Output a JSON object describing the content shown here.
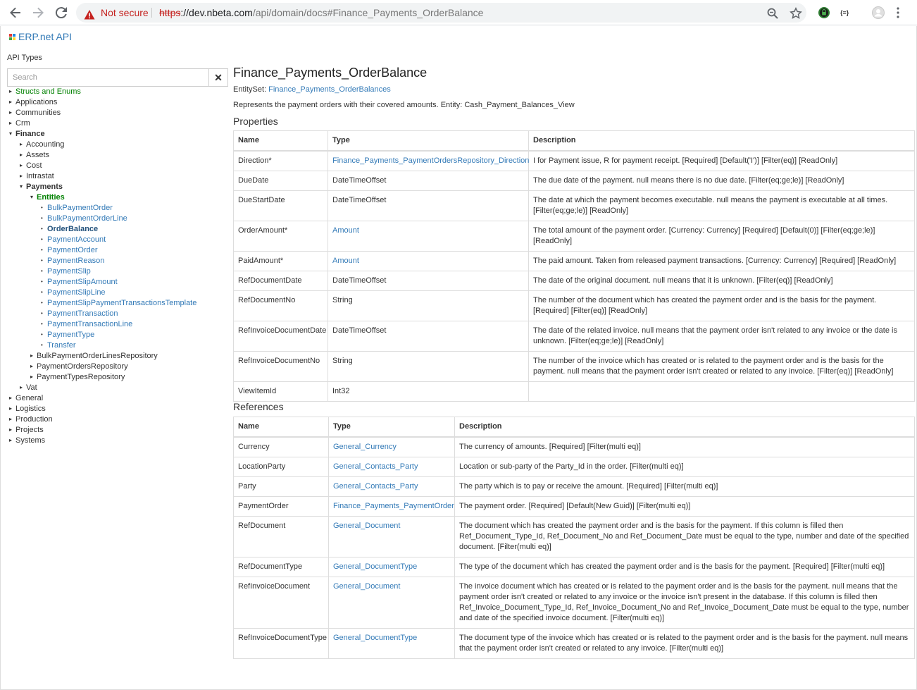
{
  "browser": {
    "security_label": "Not secure",
    "url_scheme": "https",
    "url_host": "://dev.nbeta.com",
    "url_path": "/api/domain/docs#Finance_Payments_OrderBalance"
  },
  "header": {
    "brand": "ERP.net API",
    "api_types_label": "API Types",
    "search_placeholder": "Search",
    "clear_label": "✕"
  },
  "tree": [
    {
      "label": "Structs and Enums",
      "level": 0,
      "style": "green"
    },
    {
      "label": "Applications",
      "level": 0,
      "style": "folder"
    },
    {
      "label": "Communities",
      "level": 0,
      "style": "folder"
    },
    {
      "label": "Crm",
      "level": 0,
      "style": "folder"
    },
    {
      "label": "Finance",
      "level": 0,
      "style": "bold",
      "expanded": true
    },
    {
      "label": "Accounting",
      "level": 1,
      "style": "folder"
    },
    {
      "label": "Assets",
      "level": 1,
      "style": "folder"
    },
    {
      "label": "Cost",
      "level": 1,
      "style": "folder"
    },
    {
      "label": "Intrastat",
      "level": 1,
      "style": "folder"
    },
    {
      "label": "Payments",
      "level": 1,
      "style": "bold",
      "expanded": true
    },
    {
      "label": "Entities",
      "level": 2,
      "style": "bold green",
      "expanded": true
    },
    {
      "label": "BulkPaymentOrder",
      "level": 3,
      "style": "link"
    },
    {
      "label": "BulkPaymentOrderLine",
      "level": 3,
      "style": "link"
    },
    {
      "label": "OrderBalance",
      "level": 3,
      "style": "active"
    },
    {
      "label": "PaymentAccount",
      "level": 3,
      "style": "link"
    },
    {
      "label": "PaymentOrder",
      "level": 3,
      "style": "link"
    },
    {
      "label": "PaymentReason",
      "level": 3,
      "style": "link"
    },
    {
      "label": "PaymentSlip",
      "level": 3,
      "style": "link"
    },
    {
      "label": "PaymentSlipAmount",
      "level": 3,
      "style": "link"
    },
    {
      "label": "PaymentSlipLine",
      "level": 3,
      "style": "link"
    },
    {
      "label": "PaymentSlipPaymentTransactionsTemplate",
      "level": 3,
      "style": "link"
    },
    {
      "label": "PaymentTransaction",
      "level": 3,
      "style": "link"
    },
    {
      "label": "PaymentTransactionLine",
      "level": 3,
      "style": "link"
    },
    {
      "label": "PaymentType",
      "level": 3,
      "style": "link"
    },
    {
      "label": "Transfer",
      "level": 3,
      "style": "link"
    },
    {
      "label": "BulkPaymentOrderLinesRepository",
      "level": 2,
      "style": "folder"
    },
    {
      "label": "PaymentOrdersRepository",
      "level": 2,
      "style": "folder"
    },
    {
      "label": "PaymentTypesRepository",
      "level": 2,
      "style": "folder"
    },
    {
      "label": "Vat",
      "level": 1,
      "style": "folder"
    },
    {
      "label": "General",
      "level": 0,
      "style": "folder"
    },
    {
      "label": "Logistics",
      "level": 0,
      "style": "folder"
    },
    {
      "label": "Production",
      "level": 0,
      "style": "folder"
    },
    {
      "label": "Projects",
      "level": 0,
      "style": "folder"
    },
    {
      "label": "Systems",
      "level": 0,
      "style": "folder"
    }
  ],
  "main": {
    "title": "Finance_Payments_OrderBalance",
    "entity_set_label": "EntitySet:",
    "entity_set_link": "Finance_Payments_OrderBalances",
    "summary": "Represents the payment orders with their covered amounts. Entity: Cash_Payment_Balances_View",
    "properties_heading": "Properties",
    "properties_columns": [
      "Name",
      "Type",
      "Description"
    ],
    "properties": [
      {
        "name": "Direction*",
        "type": "Finance_Payments_PaymentOrdersRepository_Direction",
        "type_link": true,
        "desc": "I for Payment issue, R for payment receipt. [Required] [Default('I')] [Filter(eq)] [ReadOnly]"
      },
      {
        "name": "DueDate",
        "type": "DateTimeOffset",
        "type_link": false,
        "desc": "The due date of the payment. null means there is no due date. [Filter(eq;ge;le)] [ReadOnly]"
      },
      {
        "name": "DueStartDate",
        "type": "DateTimeOffset",
        "type_link": false,
        "desc": "The date at which the payment becomes executable. null means the payment is executable at all times. [Filter(eq;ge;le)] [ReadOnly]"
      },
      {
        "name": "OrderAmount*",
        "type": "Amount",
        "type_link": true,
        "desc": "The total amount of the payment order. [Currency: Currency] [Required] [Default(0)] [Filter(eq;ge;le)] [ReadOnly]"
      },
      {
        "name": "PaidAmount*",
        "type": "Amount",
        "type_link": true,
        "desc": "The paid amount. Taken from released payment transactions. [Currency: Currency] [Required] [ReadOnly]"
      },
      {
        "name": "RefDocumentDate",
        "type": "DateTimeOffset",
        "type_link": false,
        "desc": "The date of the original document. null means that it is unknown. [Filter(eq)] [ReadOnly]"
      },
      {
        "name": "RefDocumentNo",
        "type": "String",
        "type_link": false,
        "desc": "The number of the document which has created the payment order and is the basis for the payment. [Required] [Filter(eq)] [ReadOnly]"
      },
      {
        "name": "RefInvoiceDocumentDate",
        "type": "DateTimeOffset",
        "type_link": false,
        "desc": "The date of the related invoice. null means that the payment order isn't related to any invoice or the date is unknown. [Filter(eq;ge;le)] [ReadOnly]"
      },
      {
        "name": "RefInvoiceDocumentNo",
        "type": "String",
        "type_link": false,
        "desc": "The number of the invoice which has created or is related to the payment order and is the basis for the payment. null means that the payment order isn't created or related to any invoice. [Filter(eq)] [ReadOnly]"
      },
      {
        "name": "ViewItemId",
        "type": "Int32",
        "type_link": false,
        "desc": ""
      }
    ],
    "references_heading": "References",
    "references_columns": [
      "Name",
      "Type",
      "Description"
    ],
    "references": [
      {
        "name": "Currency",
        "type": "General_Currency",
        "desc": "The currency of amounts. [Required] [Filter(multi eq)]"
      },
      {
        "name": "LocationParty",
        "type": "General_Contacts_Party",
        "desc": "Location or sub-party of the Party_Id in the order. [Filter(multi eq)]"
      },
      {
        "name": "Party",
        "type": "General_Contacts_Party",
        "desc": "The party which is to pay or receive the amount. [Required] [Filter(multi eq)]"
      },
      {
        "name": "PaymentOrder",
        "type": "Finance_Payments_PaymentOrder",
        "desc": "The payment order. [Required] [Default(New Guid)] [Filter(multi eq)]"
      },
      {
        "name": "RefDocument",
        "type": "General_Document",
        "desc": "The document which has created the payment order and is the basis for the payment. If this column is filled then Ref_Document_Type_Id, Ref_Document_No and Ref_Document_Date must be equal to the type, number and date of the specified document. [Filter(multi eq)]"
      },
      {
        "name": "RefDocumentType",
        "type": "General_DocumentType",
        "desc": "The type of the document which has created the payment order and is the basis for the payment. [Required] [Filter(multi eq)]"
      },
      {
        "name": "RefInvoiceDocument",
        "type": "General_Document",
        "desc": "The invoice document which has created or is related to the payment order and is the basis for the payment. null means that the payment order isn't created or related to any invoice or the invoice isn't present in the database. If this column is filled then Ref_Invoice_Document_Type_Id, Ref_Invoice_Document_No and Ref_Invoice_Document_Date must be equal to the type, number and date of the specified invoice document. [Filter(multi eq)]"
      },
      {
        "name": "RefInvoiceDocumentType",
        "type": "General_DocumentType",
        "desc": "The document type of the invoice which has created or is related to the payment order and is the basis for the payment. null means that the payment order isn't created or related to any invoice. [Filter(multi eq)]"
      }
    ]
  },
  "colors": {
    "link": "#337ab7",
    "green": "#008000",
    "warning": "#c5221f"
  }
}
